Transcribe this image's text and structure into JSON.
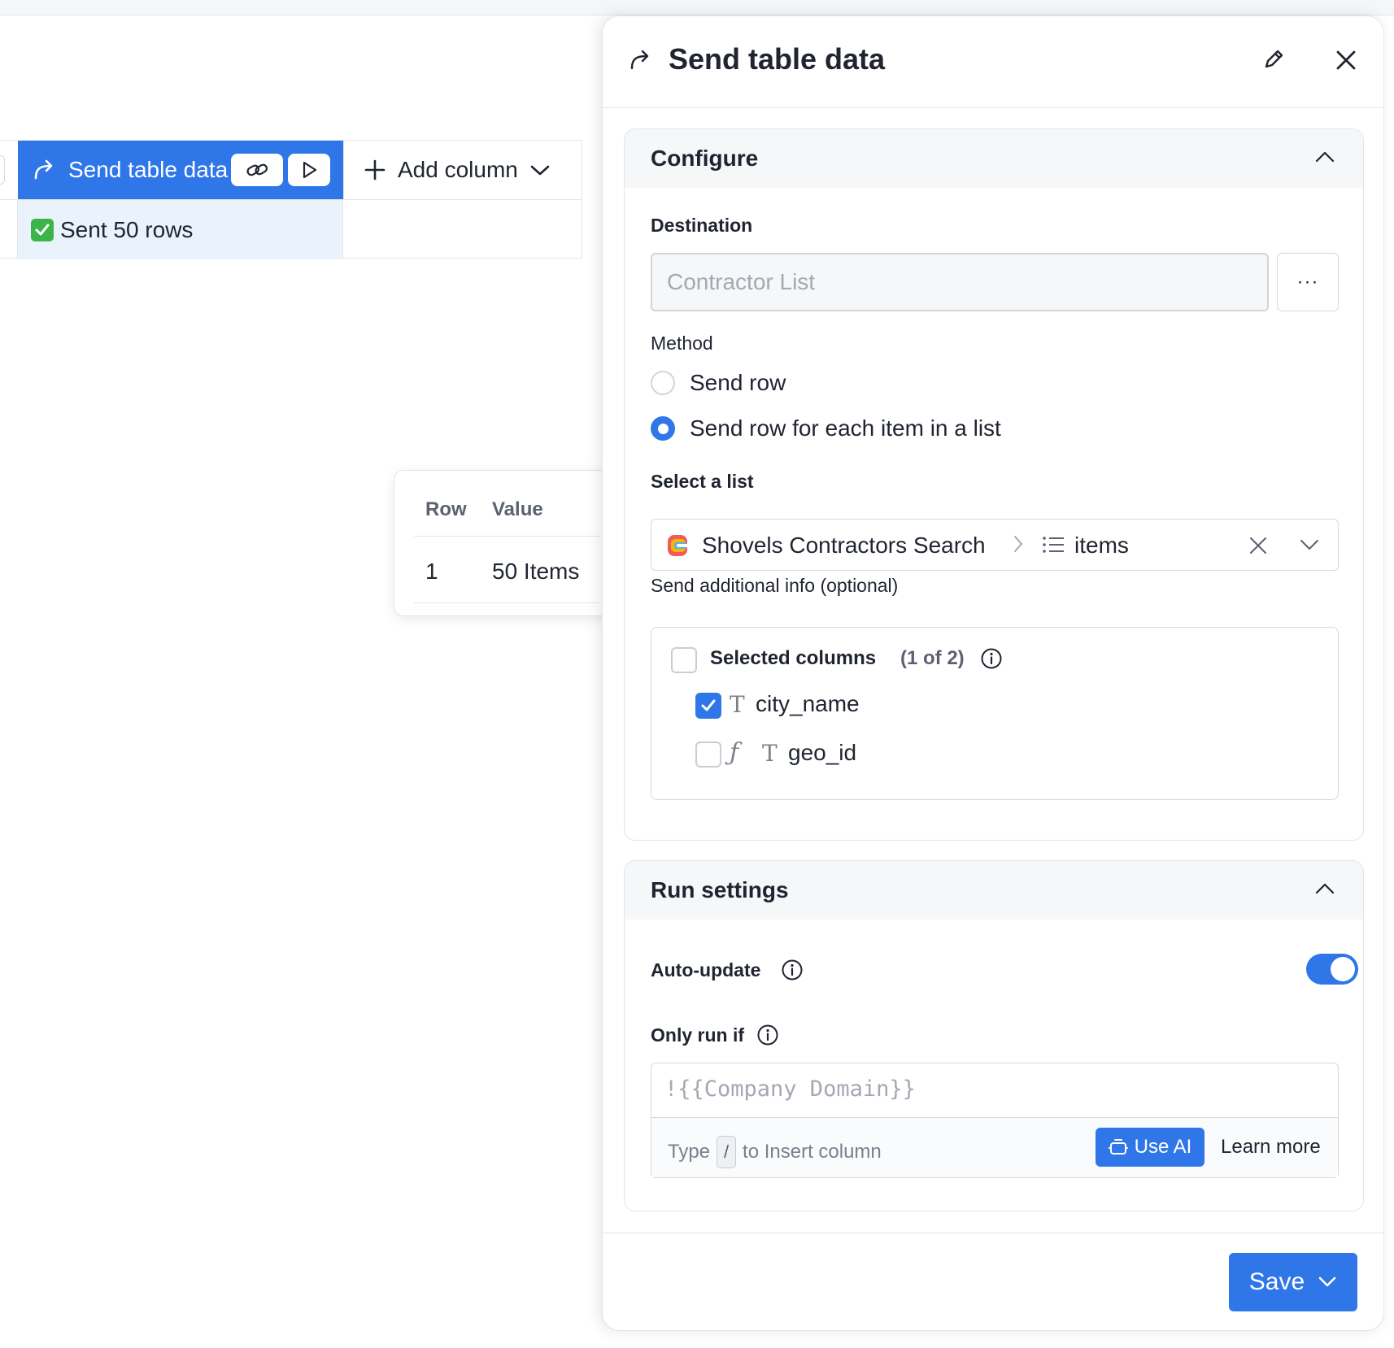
{
  "table": {
    "column_title": "Send table data",
    "add_column_label": "Add column",
    "cell_value": "Sent 50 rows"
  },
  "popover": {
    "headers": [
      "Row",
      "Value"
    ],
    "row": {
      "index": "1",
      "value": "50 Items"
    }
  },
  "panel": {
    "title": "Send table data",
    "configure": {
      "title": "Configure",
      "destination_label": "Destination",
      "destination_placeholder": "Contractor List",
      "more_label": "···",
      "method_label": "Method",
      "methods": [
        {
          "label": "Send row",
          "selected": false
        },
        {
          "label": "Send row for each item in a list",
          "selected": true
        }
      ],
      "select_list_label": "Select a list",
      "list_source": "Shovels Contractors Search",
      "list_item": "items",
      "additional_label": "Send additional info (optional)",
      "selected_columns_label": "Selected columns",
      "selected_count": "(1 of 2)",
      "columns": [
        {
          "name": "city_name",
          "checked": true,
          "formula": false
        },
        {
          "name": "geo_id",
          "checked": false,
          "formula": true
        }
      ]
    },
    "run_settings": {
      "title": "Run settings",
      "auto_update_label": "Auto-update",
      "auto_update_on": true,
      "only_run_label": "Only run if",
      "condition_placeholder": "!{{Company Domain}}",
      "hint_prefix": "Type",
      "hint_key": "/",
      "hint_suffix": "to Insert column",
      "use_ai_label": "Use AI",
      "learn_more_label": "Learn more"
    },
    "save_label": "Save"
  },
  "colors": {
    "accent": "#2f76e8",
    "cell_selected": "#eaf2fc",
    "success": "#3bb54a"
  }
}
